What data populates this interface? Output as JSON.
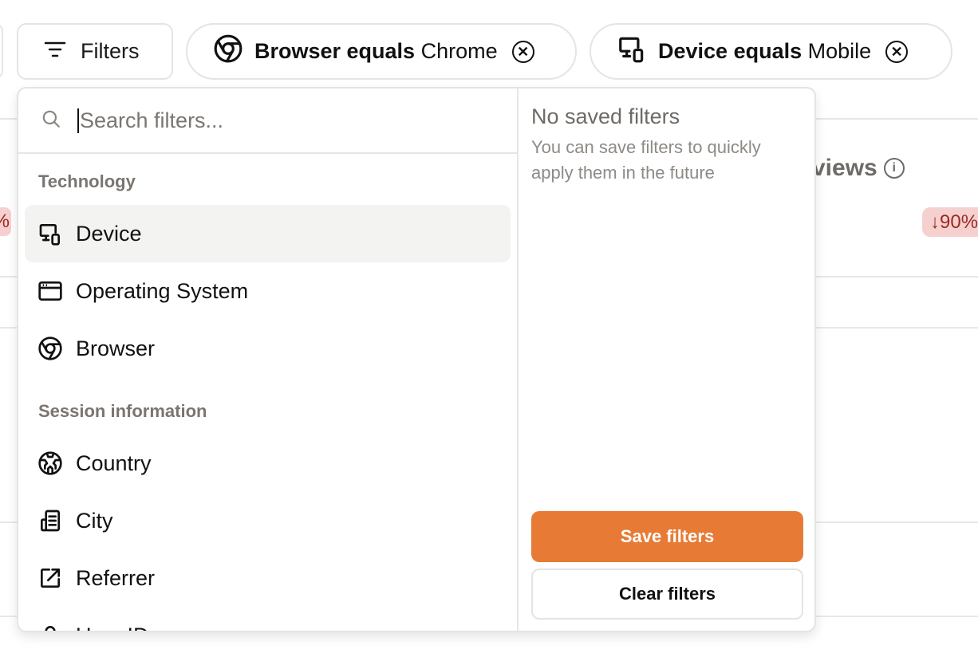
{
  "toolbar": {
    "filters_label": "Filters",
    "active_filters": [
      {
        "key": "Browser equals",
        "value": "Chrome",
        "icon": "chrome-icon"
      },
      {
        "key": "Device equals",
        "value": "Mobile",
        "icon": "device-icon"
      }
    ]
  },
  "dropdown": {
    "search": {
      "placeholder": "Search filters...",
      "value": ""
    },
    "sections": [
      {
        "label": "Technology",
        "items": [
          {
            "label": "Device",
            "icon": "device-icon",
            "active": true
          },
          {
            "label": "Operating System",
            "icon": "window-icon"
          },
          {
            "label": "Browser",
            "icon": "chrome-icon"
          }
        ]
      },
      {
        "label": "Session information",
        "items": [
          {
            "label": "Country",
            "icon": "globe-icon"
          },
          {
            "label": "City",
            "icon": "building-icon"
          },
          {
            "label": "Referrer",
            "icon": "external-link-icon"
          },
          {
            "label": "User ID",
            "icon": "user-icon"
          }
        ]
      }
    ],
    "saved": {
      "title": "No saved filters",
      "description": "You can save filters to quickly apply them in the future",
      "save_label": "Save filters",
      "clear_label": "Clear filters"
    }
  },
  "background": {
    "metric_title_partial": "views",
    "left_change_partial": "%",
    "right_change_partial": "↓90%"
  },
  "colors": {
    "accent": "#e77b36",
    "negative_badge_bg": "#f6d0cf",
    "negative_badge_text": "#9b2a22"
  }
}
